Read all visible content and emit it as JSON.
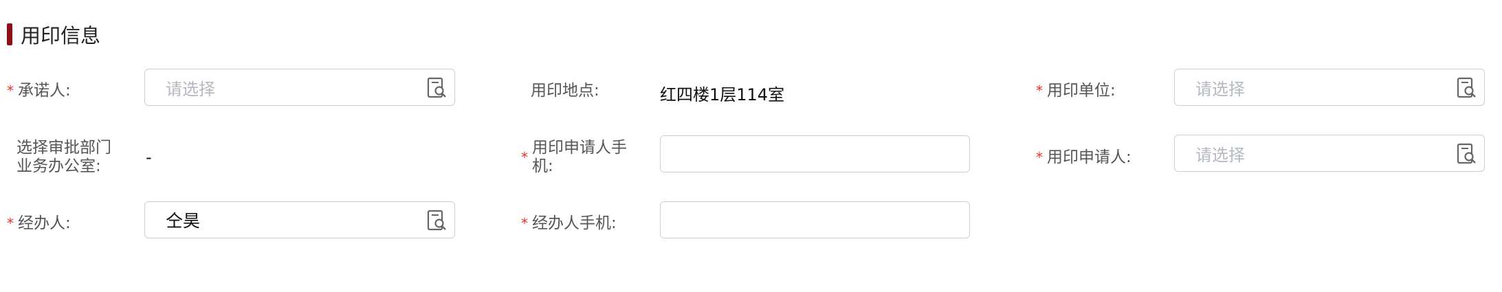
{
  "section": {
    "title": "用印信息"
  },
  "fields": {
    "promisor": {
      "label": "承诺人:",
      "required": "*",
      "placeholder": "请选择"
    },
    "location": {
      "label": "用印地点:",
      "value": "红四楼1层114室"
    },
    "unit": {
      "label": "用印单位:",
      "required": "*",
      "placeholder": "请选择"
    },
    "approval_office": {
      "label_line1": "选择审批部门",
      "label_line2": "业务办公室:",
      "value": "-"
    },
    "applicant_phone": {
      "label_line1": "用印申请人手",
      "label_line2": "机:",
      "required": "*",
      "value": ""
    },
    "applicant": {
      "label": "用印申请人:",
      "required": "*",
      "placeholder": "请选择"
    },
    "handler": {
      "label": "经办人:",
      "required": "*",
      "value": "仝昊"
    },
    "handler_phone": {
      "label": "经办人手机:",
      "required": "*",
      "value": ""
    }
  },
  "icons": {
    "picker": "contact-book-search-icon"
  },
  "colors": {
    "accent": "#8b1018",
    "required": "#e0352b",
    "placeholder": "#b4b9c0",
    "border": "#cfcfcf"
  }
}
